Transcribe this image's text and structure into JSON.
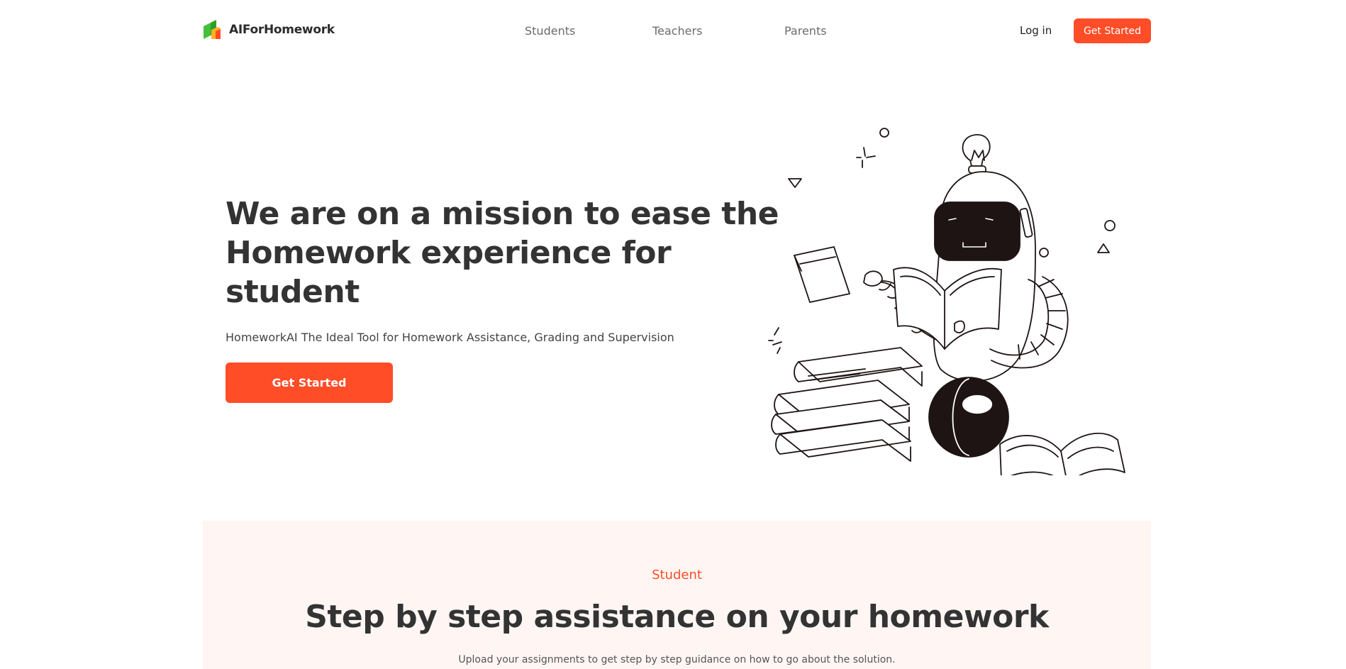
{
  "brand": {
    "name": "AIForHomework"
  },
  "nav": {
    "students": "Students",
    "teachers": "Teachers",
    "parents": "Parents"
  },
  "header": {
    "login_label": "Log in",
    "cta_label": "Get Started"
  },
  "hero": {
    "title": "We are on a mission to ease the Homework experience for student",
    "subtitle": "HomeworkAI The Ideal Tool for Homework Assistance, Grading and Supervision",
    "cta_label": "Get Started"
  },
  "student_section": {
    "eyebrow": "Student",
    "title": "Step by step assistance on your homework",
    "subtitle": "Upload your assignments to get step by step guidance on how to go about the solution."
  },
  "colors": {
    "accent": "#ff4d28",
    "section_bg": "#fff6f4",
    "text_dark": "#333333"
  },
  "icons": {
    "logo": "book-stack-logo-icon",
    "illustration": "robot-reading-book-illustration"
  }
}
